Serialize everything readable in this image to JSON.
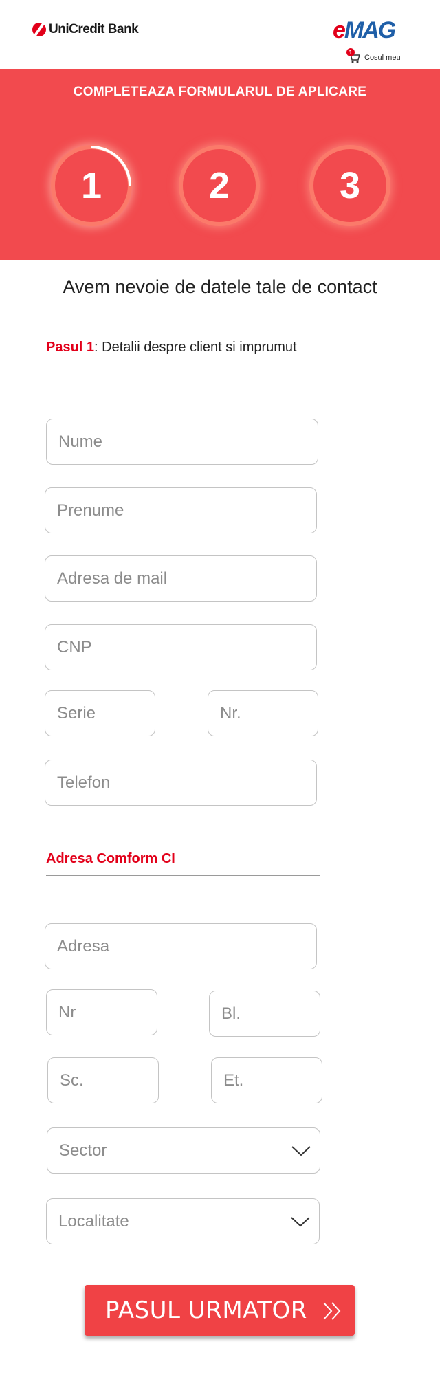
{
  "header": {
    "bank_logo": "UniCredit Bank",
    "shop_logo_e": "e",
    "shop_logo_rest": "MAG",
    "cart_count": "1",
    "cart_label": "Cosul meu"
  },
  "banner": {
    "title": "COMPLETEAZA FORMULARUL DE APLICARE",
    "steps": [
      "1",
      "2",
      "3"
    ],
    "active_step": 1
  },
  "subtitle": "Avem nevoie de datele tale de contact",
  "section1": {
    "step_label": "Pasul 1",
    "separator": ":",
    "text": " Detalii despre client si imprumut"
  },
  "section2": {
    "title": "Adresa Comform CI"
  },
  "fields": {
    "nume": "Nume",
    "prenume": "Prenume",
    "email": "Adresa de mail",
    "cnp": "CNP",
    "serie": "Serie",
    "nr_ci": "Nr.",
    "telefon": "Telefon",
    "adresa": "Adresa",
    "nr": "Nr",
    "bl": "Bl.",
    "sc": "Sc.",
    "et": "Et.",
    "sector": "Sector",
    "localitate": "Localitate"
  },
  "submit": {
    "label": "PASUL URMATOR"
  },
  "colors": {
    "brand_red": "#f24a4e",
    "accent_red": "#e2001a",
    "emag_blue": "#1f5fa8"
  },
  "icons": {
    "cart": "shopping-cart-icon",
    "chevron": "chevron-down-icon",
    "next": "double-chevron-right-icon"
  }
}
